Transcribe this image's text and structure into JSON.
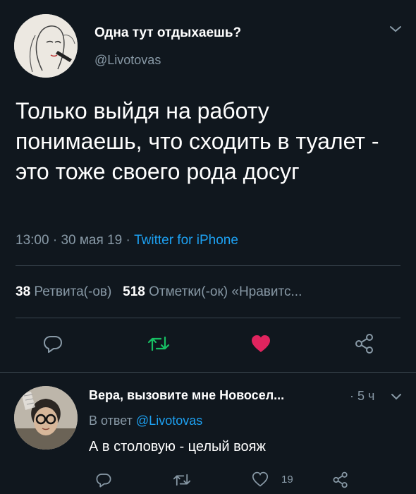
{
  "tweet": {
    "author_name": "Одна тут отдыхаешь?",
    "author_handle": "@Livotovas",
    "text": "Только выйдя на работу понимаешь, что сходить в туалет - это тоже своего рода досуг",
    "time": "13:00",
    "date": "30 мая 19",
    "separator": "·",
    "source": "Twitter for iPhone",
    "retweets_count": "38",
    "retweets_label": "Ретвита(-ов)",
    "likes_count": "518",
    "likes_label": "Отметки(-ок) «Нравитс..."
  },
  "reply": {
    "author_name": "Вера, вызовите мне Новосел...",
    "time": "· 5 ч",
    "reply_prefix": "В ответ",
    "reply_handle": "@Livotovas",
    "text": "А в столовую - целый вояж",
    "likes_count": "19"
  },
  "colors": {
    "background": "#10171e",
    "text_secondary": "#8899a6",
    "link": "#1da1f2",
    "like_active": "#e0245e",
    "retweet_active": "#17bf63",
    "divider": "#38444d"
  },
  "icons": {
    "reply": "reply-icon",
    "retweet": "retweet-icon",
    "like": "heart-icon",
    "share": "share-icon",
    "menu": "chevron-down-icon"
  }
}
